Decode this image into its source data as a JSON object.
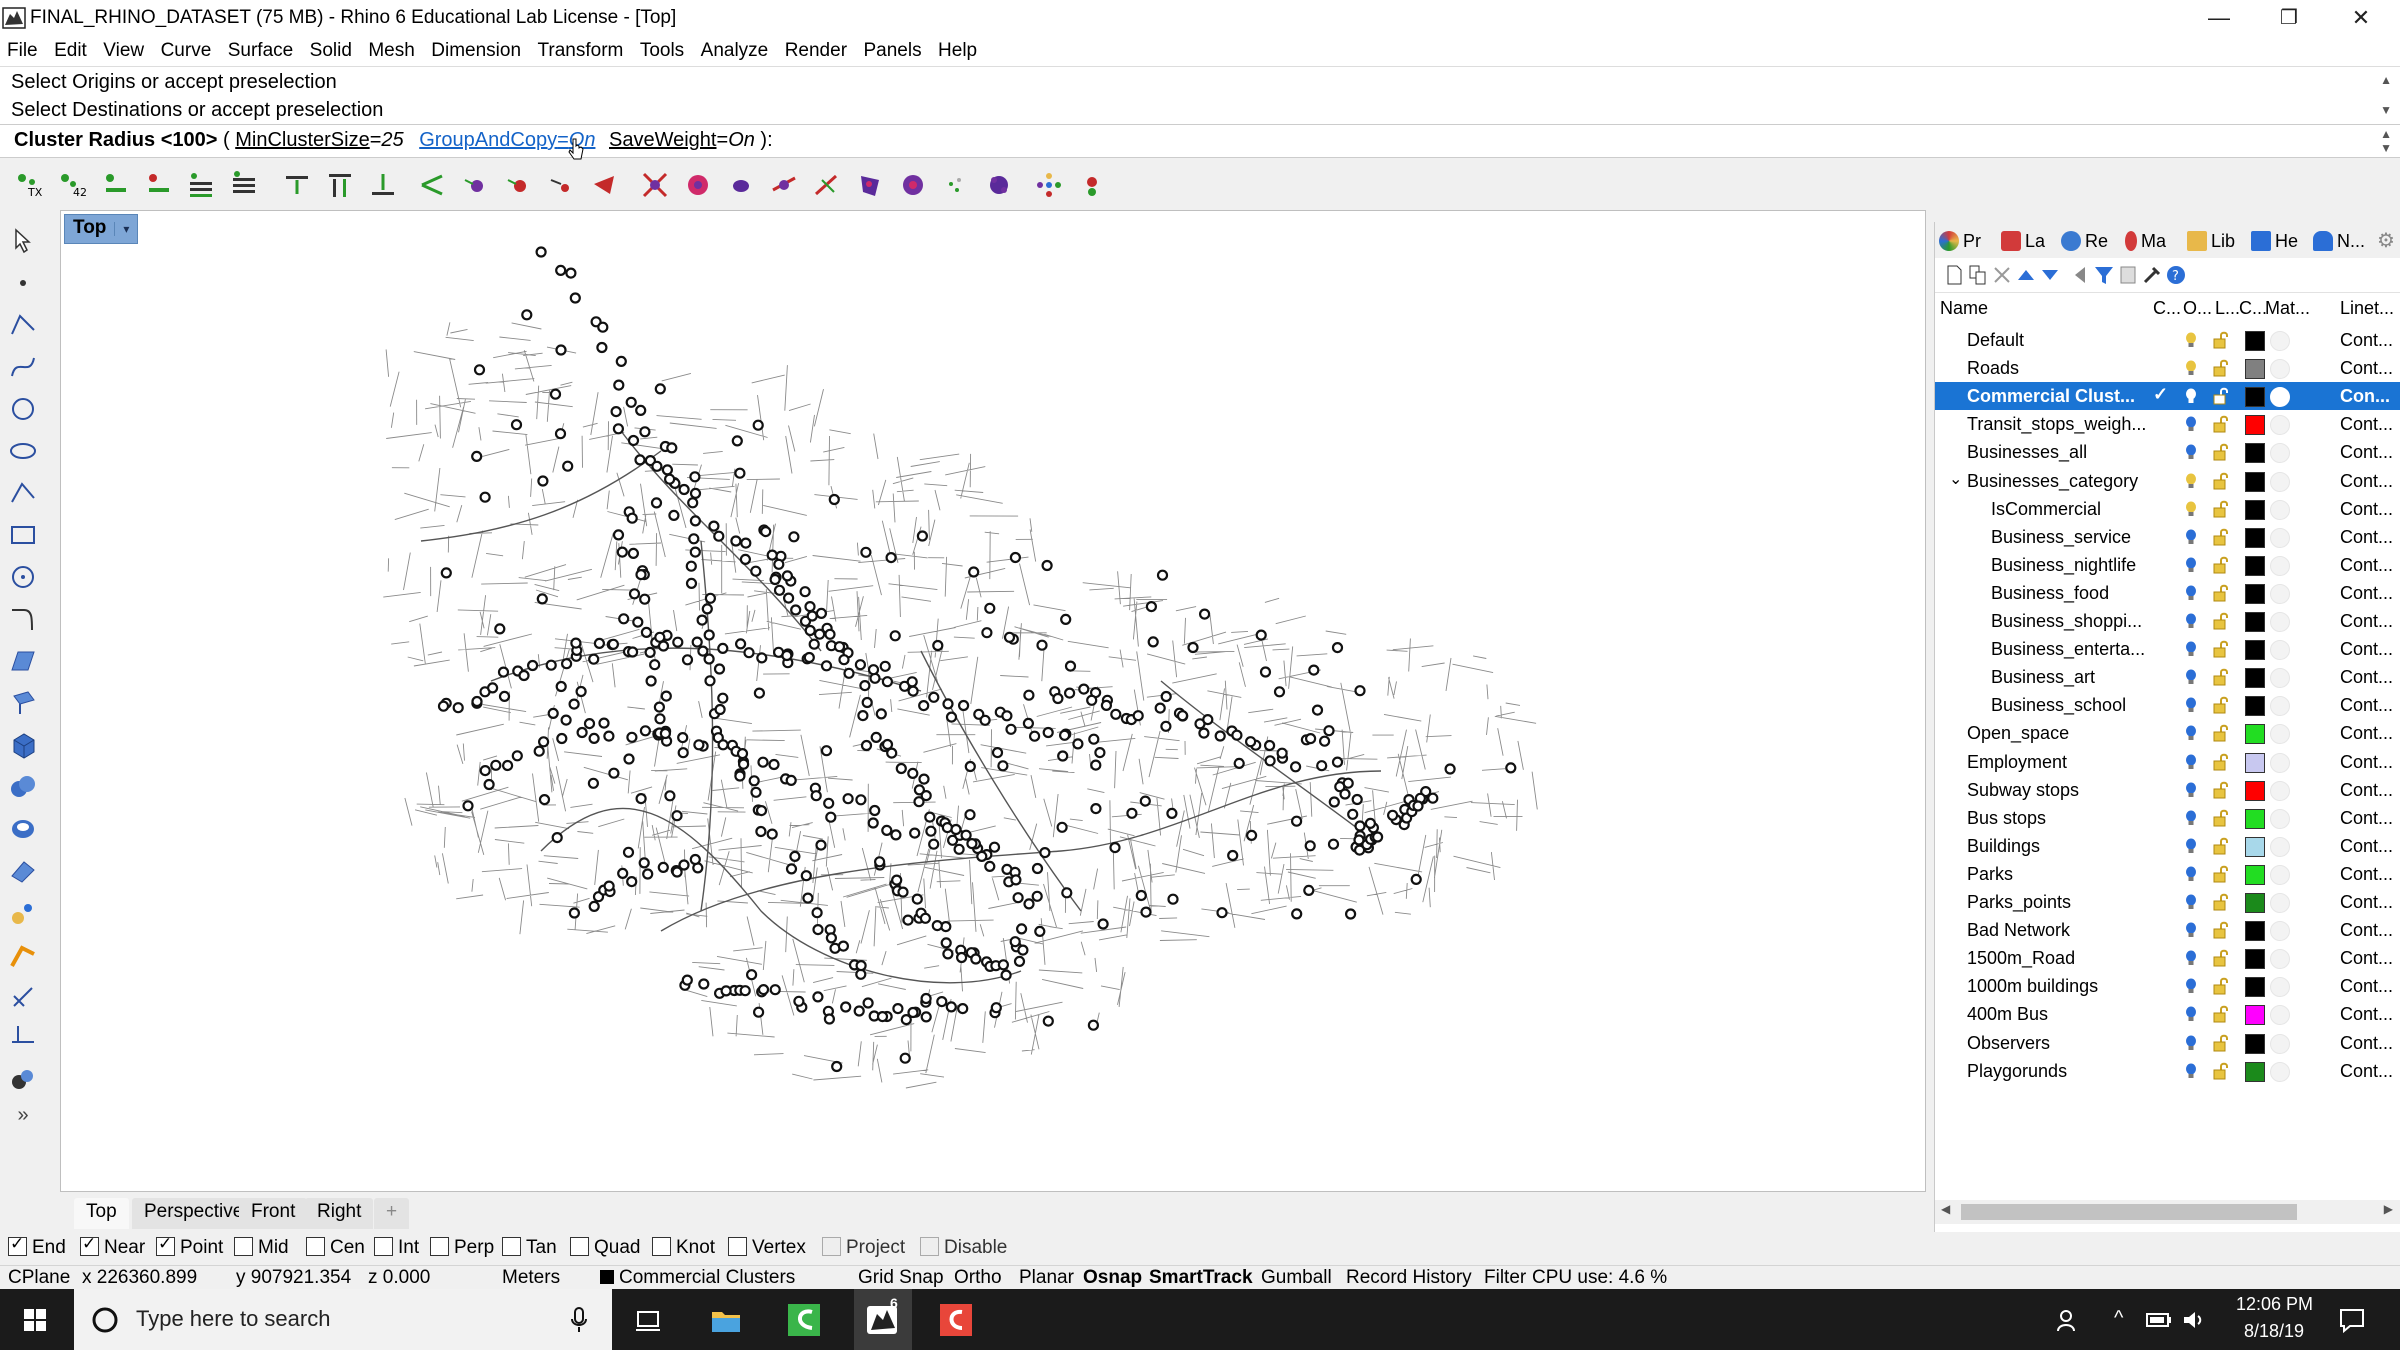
{
  "window": {
    "title": "FINAL_RHINO_DATASET (75 MB) - Rhino 6 Educational Lab License - [Top]",
    "minimize": "—",
    "restore": "❐",
    "close": "✕"
  },
  "menu": [
    "File",
    "Edit",
    "View",
    "Curve",
    "Surface",
    "Solid",
    "Mesh",
    "Dimension",
    "Transform",
    "Tools",
    "Analyze",
    "Render",
    "Panels",
    "Help"
  ],
  "command": {
    "history": [
      "Select Origins or accept preselection",
      "Select Destinations or accept preselection"
    ],
    "prompt_bold": "Cluster Radius <100>",
    "paren_open": " ( ",
    "opt1_name": "MinClusterSize",
    "opt1_value": "25",
    "opt2_name": "GroupAndCopy",
    "opt2_value": "On",
    "opt3_name": "SaveWeight",
    "opt3_value": "On",
    "paren_close": " ):"
  },
  "viewport": {
    "label": "Top",
    "dropdown": "▾",
    "tabs": [
      "Top",
      "Perspective",
      "Front",
      "Right"
    ],
    "add_tab": "+"
  },
  "panel": {
    "tabs": [
      {
        "label": "Pr",
        "icon": "properties-icon",
        "color": "#d23a3a"
      },
      {
        "label": "La",
        "icon": "layers-icon",
        "color": "#2b6ed6"
      },
      {
        "label": "Re",
        "icon": "render-icon",
        "color": "#3a7ad1"
      },
      {
        "label": "Ma",
        "icon": "materials-icon",
        "color": "#d23a3a"
      },
      {
        "label": "Lib",
        "icon": "libraries-icon",
        "color": "#e8b84a"
      },
      {
        "label": "He",
        "icon": "help-icon",
        "color": "#2b6ed6"
      },
      {
        "label": "N...",
        "icon": "notifications-icon",
        "color": "#2b6ed6"
      }
    ],
    "columns": {
      "name": "Name",
      "current": "C...",
      "on": "O...",
      "lock": "L...",
      "color": "C...",
      "material": "Mat...",
      "linetype": "Linet..."
    },
    "layers": [
      {
        "name": "Default",
        "indent": 0,
        "bulb": "#e8c440",
        "color": "#000000",
        "linetype": "Cont..."
      },
      {
        "name": "Roads",
        "indent": 0,
        "bulb": "#e8c440",
        "color": "#808080",
        "linetype": "Cont..."
      },
      {
        "name": "Commercial Clust...",
        "indent": 0,
        "bulb": "#ffffff",
        "color": "#000000",
        "linetype": "Con...",
        "selected": true,
        "current": "✓"
      },
      {
        "name": "Transit_stops_weigh...",
        "indent": 0,
        "bulb": "#2b6ed6",
        "color": "#ff0000",
        "linetype": "Cont..."
      },
      {
        "name": "Businesses_all",
        "indent": 0,
        "bulb": "#2b6ed6",
        "color": "#000000",
        "linetype": "Cont..."
      },
      {
        "name": "Businesses_category",
        "indent": 0,
        "bulb": "#e8c440",
        "color": "#000000",
        "linetype": "Cont...",
        "expander": "⌄"
      },
      {
        "name": "IsCommercial",
        "indent": 1,
        "bulb": "#e8c440",
        "color": "#000000",
        "linetype": "Cont..."
      },
      {
        "name": "Business_service",
        "indent": 1,
        "bulb": "#2b6ed6",
        "color": "#000000",
        "linetype": "Cont..."
      },
      {
        "name": "Business_nightlife",
        "indent": 1,
        "bulb": "#2b6ed6",
        "color": "#000000",
        "linetype": "Cont..."
      },
      {
        "name": "Business_food",
        "indent": 1,
        "bulb": "#2b6ed6",
        "color": "#000000",
        "linetype": "Cont..."
      },
      {
        "name": "Business_shoppi...",
        "indent": 1,
        "bulb": "#2b6ed6",
        "color": "#000000",
        "linetype": "Cont..."
      },
      {
        "name": "Business_enterta...",
        "indent": 1,
        "bulb": "#2b6ed6",
        "color": "#000000",
        "linetype": "Cont..."
      },
      {
        "name": "Business_art",
        "indent": 1,
        "bulb": "#2b6ed6",
        "color": "#000000",
        "linetype": "Cont..."
      },
      {
        "name": "Business_school",
        "indent": 1,
        "bulb": "#2b6ed6",
        "color": "#000000",
        "linetype": "Cont..."
      },
      {
        "name": "Open_space",
        "indent": 0,
        "bulb": "#2b6ed6",
        "color": "#22dd22",
        "linetype": "Cont..."
      },
      {
        "name": "Employment",
        "indent": 0,
        "bulb": "#2b6ed6",
        "color": "#c8c8f0",
        "linetype": "Cont..."
      },
      {
        "name": "Subway stops",
        "indent": 0,
        "bulb": "#2b6ed6",
        "color": "#ff0000",
        "linetype": "Cont..."
      },
      {
        "name": "Bus stops",
        "indent": 0,
        "bulb": "#2b6ed6",
        "color": "#22dd22",
        "linetype": "Cont..."
      },
      {
        "name": "Buildings",
        "indent": 0,
        "bulb": "#2b6ed6",
        "color": "#a8d8ea",
        "linetype": "Cont..."
      },
      {
        "name": "Parks",
        "indent": 0,
        "bulb": "#2b6ed6",
        "color": "#22dd22",
        "linetype": "Cont..."
      },
      {
        "name": "Parks_points",
        "indent": 0,
        "bulb": "#2b6ed6",
        "color": "#1b8a1b",
        "linetype": "Cont..."
      },
      {
        "name": "Bad Network",
        "indent": 0,
        "bulb": "#2b6ed6",
        "color": "#000000",
        "linetype": "Cont..."
      },
      {
        "name": "1500m_Road",
        "indent": 0,
        "bulb": "#2b6ed6",
        "color": "#000000",
        "linetype": "Cont..."
      },
      {
        "name": "1000m buildings",
        "indent": 0,
        "bulb": "#2b6ed6",
        "color": "#000000",
        "linetype": "Cont..."
      },
      {
        "name": "400m Bus",
        "indent": 0,
        "bulb": "#2b6ed6",
        "color": "#ff00ff",
        "linetype": "Cont..."
      },
      {
        "name": "Observers",
        "indent": 0,
        "bulb": "#2b6ed6",
        "color": "#000000",
        "linetype": "Cont..."
      },
      {
        "name": "Playgorunds",
        "indent": 0,
        "bulb": "#2b6ed6",
        "color": "#1b8a1b",
        "linetype": "Cont..."
      }
    ]
  },
  "osnap": [
    {
      "label": "End",
      "checked": true
    },
    {
      "label": "Near",
      "checked": true
    },
    {
      "label": "Point",
      "checked": true
    },
    {
      "label": "Mid",
      "checked": false
    },
    {
      "label": "Cen",
      "checked": false
    },
    {
      "label": "Int",
      "checked": false
    },
    {
      "label": "Perp",
      "checked": false
    },
    {
      "label": "Tan",
      "checked": false
    },
    {
      "label": "Quad",
      "checked": false
    },
    {
      "label": "Knot",
      "checked": false
    },
    {
      "label": "Vertex",
      "checked": false
    },
    {
      "label": "Project",
      "checked": false,
      "disabled": true
    },
    {
      "label": "Disable",
      "checked": false,
      "disabled": true
    }
  ],
  "status": {
    "cplane": "CPlane",
    "x": "x 226360.899",
    "y": "y 907921.354",
    "z": "z 0.000",
    "units": "Meters",
    "layer": "Commercial Clusters",
    "grid_snap": "Grid Snap",
    "ortho": "Ortho",
    "planar": "Planar",
    "osnap": "Osnap",
    "smarttrack": "SmartTrack",
    "gumball": "Gumball",
    "record_history": "Record History",
    "filter": "Filter",
    "cpu": "CPU use: 4.6 %"
  },
  "taskbar": {
    "search_placeholder": "Type here to search",
    "time": "12:06 PM",
    "date": "8/18/19",
    "rhino_badge": "6"
  },
  "colors": {
    "accent": "#1a74d4",
    "viewport_label": "#7ea6d6",
    "taskbar": "#1b1b1b"
  }
}
